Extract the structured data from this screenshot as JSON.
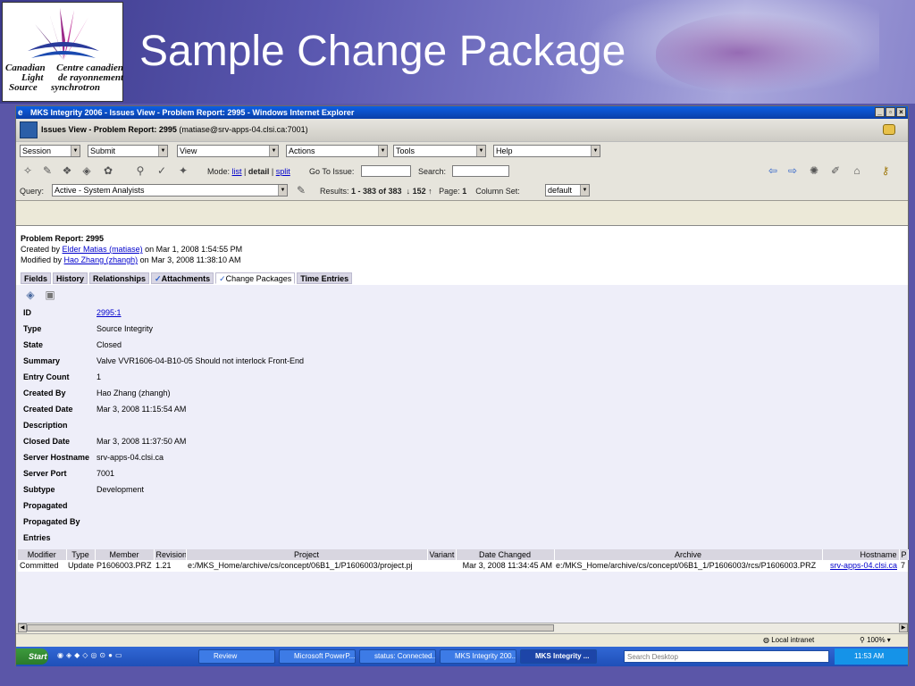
{
  "slide": {
    "title": "Sample Change Package",
    "logo": {
      "line1_en": "Canadian",
      "line1_fr": "Centre canadien",
      "line2_en": "Light",
      "line2_fr": "de rayonnement",
      "line3_en": "Source",
      "line3_fr": "synchrotron"
    }
  },
  "window": {
    "title": "MKS Integrity 2006 - Issues View - Problem Report: 2995 - Windows Internet Explorer",
    "app_title": "Issues View - Problem Report: 2995",
    "app_subtitle": "(matiase@srv-apps-04.clsi.ca:7001)"
  },
  "menus": [
    "Session",
    "Submit",
    "View",
    "Actions",
    "Tools",
    "Help"
  ],
  "toolbar": {
    "mode_label": "Mode:",
    "mode_list": "list",
    "mode_detail": "detail",
    "mode_split": "split",
    "goto_label": "Go To Issue:",
    "search_label": "Search:"
  },
  "query": {
    "label": "Query:",
    "value": "Active - System Analyists",
    "results_label": "Results:",
    "results_value": "1 - 383 of 383",
    "sort_value": "152",
    "page_label": "Page:",
    "page_value": "1",
    "colset_label": "Column Set:",
    "colset_value": "default"
  },
  "report": {
    "title": "Problem Report: 2995",
    "created_prefix": "Created by",
    "created_by": "Elder Matias (matiase)",
    "created_on": "on Mar 1, 2008 1:54:55 PM",
    "modified_prefix": "Modified by",
    "modified_by": "Hao Zhang (zhangh)",
    "modified_on": "on Mar 3, 2008 11:38:10 AM"
  },
  "tabs": [
    "Fields",
    "History",
    "Relationships",
    "Attachments",
    "Change Packages",
    "Time Entries"
  ],
  "fields": [
    {
      "label": "ID",
      "value": "2995:1"
    },
    {
      "label": "Type",
      "value": "Source Integrity"
    },
    {
      "label": "State",
      "value": "Closed"
    },
    {
      "label": "Summary",
      "value": "Valve VVR1606-04-B10-05 Should not interlock Front-End"
    },
    {
      "label": "Entry Count",
      "value": "1"
    },
    {
      "label": "Created By",
      "value": "Hao Zhang (zhangh)"
    },
    {
      "label": "Created Date",
      "value": "Mar 3, 2008 11:15:54 AM"
    },
    {
      "label": "Description",
      "value": ""
    },
    {
      "label": "Closed Date",
      "value": "Mar 3, 2008 11:37:50 AM"
    },
    {
      "label": "Server Hostname",
      "value": "srv-apps-04.clsi.ca"
    },
    {
      "label": "Server Port",
      "value": "7001"
    },
    {
      "label": "Subtype",
      "value": "Development"
    },
    {
      "label": "Propagated",
      "value": ""
    },
    {
      "label": "Propagated By",
      "value": ""
    },
    {
      "label": "Entries",
      "value": ""
    }
  ],
  "entries": {
    "headers": [
      "Modifier",
      "Type",
      "Member",
      "Revision",
      "Project",
      "Variant",
      "Date Changed",
      "Archive",
      "Hostname",
      "P"
    ],
    "rows": [
      [
        "Committed",
        "Update",
        "P1606003.PRZ",
        "1.21",
        "e:/MKS_Home/archive/cs/concept/06B1_1/P1606003/project.pj",
        "",
        "Mar 3, 2008 11:34:45 AM",
        "e:/MKS_Home/archive/cs/concept/06B1_1/P1606003/rcs/P1606003.PRZ",
        "srv-apps-04.clsi.ca",
        "7"
      ]
    ]
  },
  "statusbar": {
    "zone": "Local intranet",
    "zoom": "100%"
  },
  "taskbar": {
    "start": "Start",
    "items": [
      "Review",
      "Microsoft PowerP...",
      "status: Connected...",
      "MKS Integrity 200...",
      "MKS Integrity ..."
    ],
    "search_placeholder": "Search Desktop",
    "clock": "11:53 AM"
  }
}
